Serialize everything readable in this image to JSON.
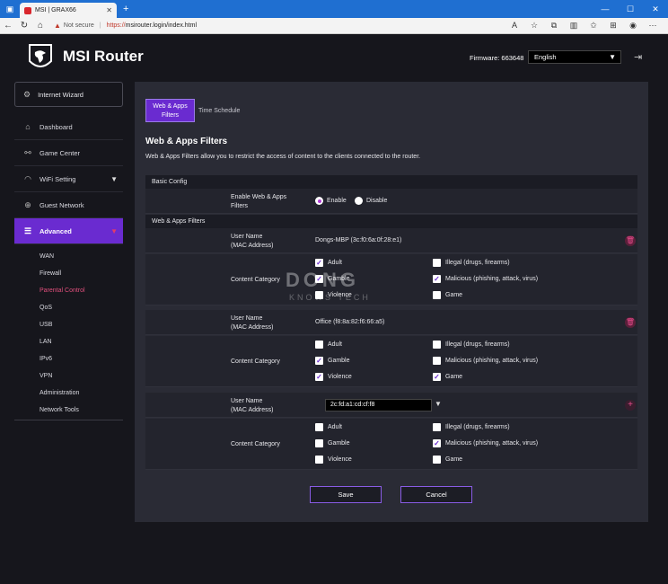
{
  "browser": {
    "tab_title": "MSI | GRAX66",
    "not_secure": "Not secure",
    "url_scheme": "https://",
    "url_rest": "msirouter.login/index.html"
  },
  "header": {
    "brand": "MSI Router",
    "firmware": "Firmware: 663648",
    "language": "English"
  },
  "sidebar": {
    "wizard": "Internet Wizard",
    "items": [
      {
        "label": "Dashboard",
        "icon": "home-icon"
      },
      {
        "label": "Game Center",
        "icon": "gamepad-icon"
      },
      {
        "label": "WiFi Setting",
        "icon": "wifi-icon"
      },
      {
        "label": "Guest Network",
        "icon": "globe-icon"
      },
      {
        "label": "Advanced",
        "icon": "sliders-icon"
      }
    ],
    "subitems": [
      "WAN",
      "Firewall",
      "Parental Control",
      "QoS",
      "USB",
      "LAN",
      "IPv6",
      "VPN",
      "Administration",
      "Network Tools"
    ]
  },
  "tabs": {
    "active": "Web & Apps Filters",
    "other": "Time Schedule"
  },
  "page": {
    "title": "Web & Apps Filters",
    "description": "Web & Apps Filters allow you to restrict the access of content to the clients connected to the router."
  },
  "basic": {
    "heading": "Basic Config",
    "enable_label": "Enable Web & Apps Filters",
    "enable": "Enable",
    "disable": "Disable"
  },
  "filters": {
    "heading": "Web & Apps Filters",
    "user_label": "User Name\n(MAC Address)",
    "category_label": "Content Category",
    "categories": [
      "Adult",
      "Gamble",
      "Violence",
      "Illegal (drugs, firearms)",
      "Malicious (phishing, attack, virus)",
      "Game"
    ],
    "entries": [
      {
        "name": "Dongs-MBP (3c:f0:6a:0f:28:e1)",
        "checked": [
          true,
          true,
          false,
          false,
          true,
          false
        ]
      },
      {
        "name": "Office (f8:8a:82:f6:66:a5)",
        "checked": [
          false,
          true,
          true,
          false,
          false,
          true
        ]
      },
      {
        "name": "2c:fd:a1:cd:cf:f8",
        "checked": [
          false,
          false,
          false,
          false,
          true,
          false
        ]
      }
    ]
  },
  "actions": {
    "save": "Save",
    "cancel": "Cancel"
  },
  "watermark": {
    "line1": "DONG",
    "line2": "KNOWS TECH"
  }
}
